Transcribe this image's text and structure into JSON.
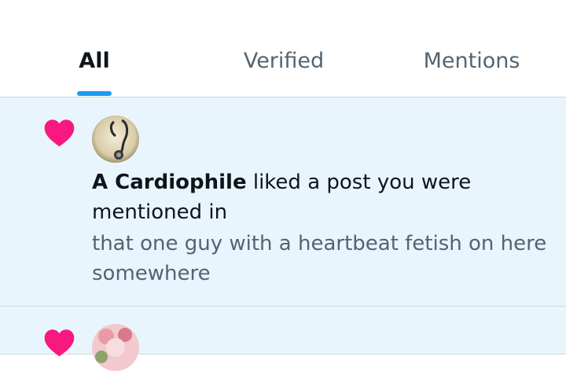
{
  "tabs": [
    {
      "label": "All",
      "active": true
    },
    {
      "label": "Verified",
      "active": false
    },
    {
      "label": "Mentions",
      "active": false
    }
  ],
  "colors": {
    "accent": "#1d9bf0",
    "heart": "#f91880",
    "unread_bg": "#e8f5fd"
  },
  "notifications": [
    {
      "icon": "heart-icon",
      "actor": "A Cardiophile",
      "action": " liked a post you were mentioned in",
      "post_text": "that one guy with a heartbeat fetish on here somewhere"
    },
    {
      "icon": "heart-icon"
    }
  ]
}
